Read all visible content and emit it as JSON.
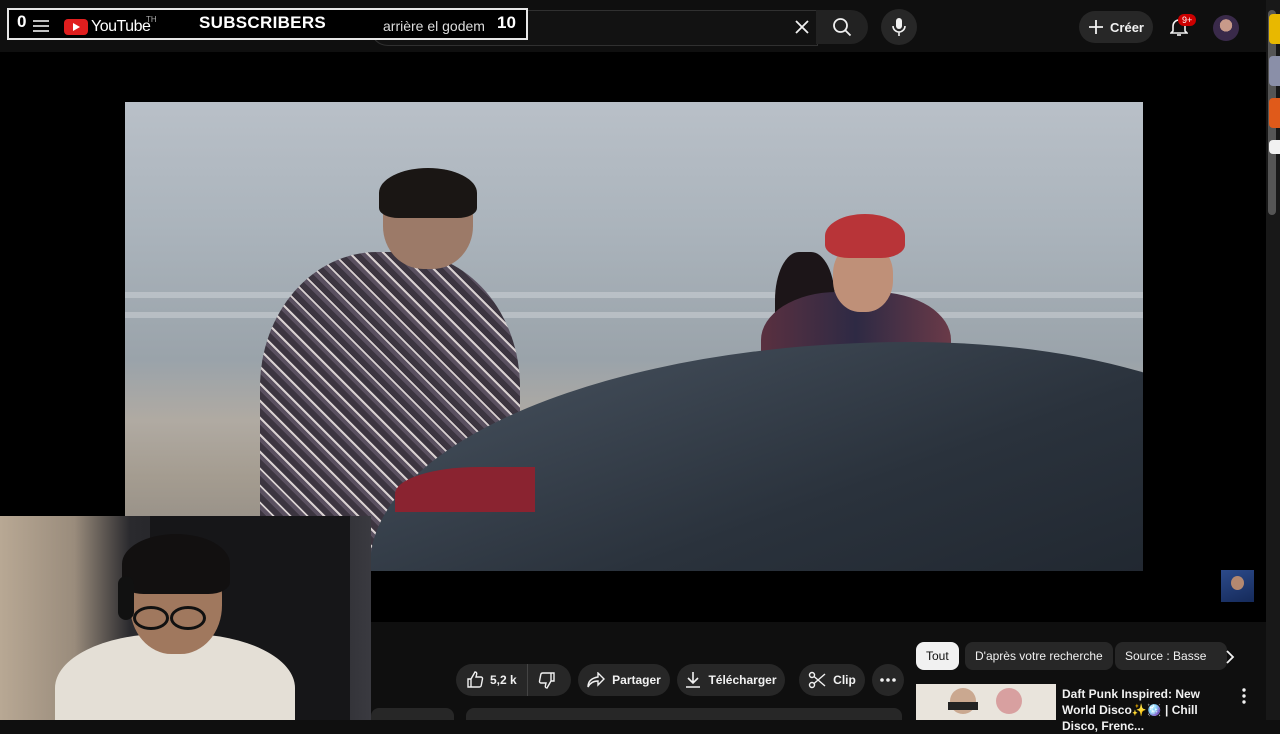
{
  "overlay": {
    "subscriber_count": "0",
    "logo_text": "YouTube",
    "logo_country": "TH",
    "label": "SUBSCRIBERS",
    "query": "arrière el godem",
    "number": "10"
  },
  "topbar": {
    "create_label": "Créer",
    "notifications_badge": "9+"
  },
  "actions": {
    "likes": "5,2 k",
    "share": "Partager",
    "download": "Télécharger",
    "clip": "Clip"
  },
  "filter_chips": [
    {
      "label": "Tout",
      "selected": true
    },
    {
      "label": "D'après votre recherche",
      "selected": false
    },
    {
      "label": "Source : Basse",
      "selected": false
    }
  ],
  "recommendation": {
    "title": "Daft Punk Inspired: New World Disco✨🪩 | Chill Disco, Frenc..."
  },
  "colors": {
    "background": "#0f0f0f",
    "pill": "#272727",
    "selected_chip": "#f1f1f1",
    "badge": "#cc0000"
  },
  "icons": {
    "menu": "menu-icon",
    "clear": "close-icon",
    "search": "search-icon",
    "mic": "mic-icon",
    "create": "plus-icon",
    "notifications": "bell-icon",
    "like": "thumbs-up-icon",
    "dislike": "thumbs-down-icon",
    "share": "share-icon",
    "download": "download-icon",
    "clip": "scissors-icon",
    "more": "more-horizontal-icon"
  }
}
